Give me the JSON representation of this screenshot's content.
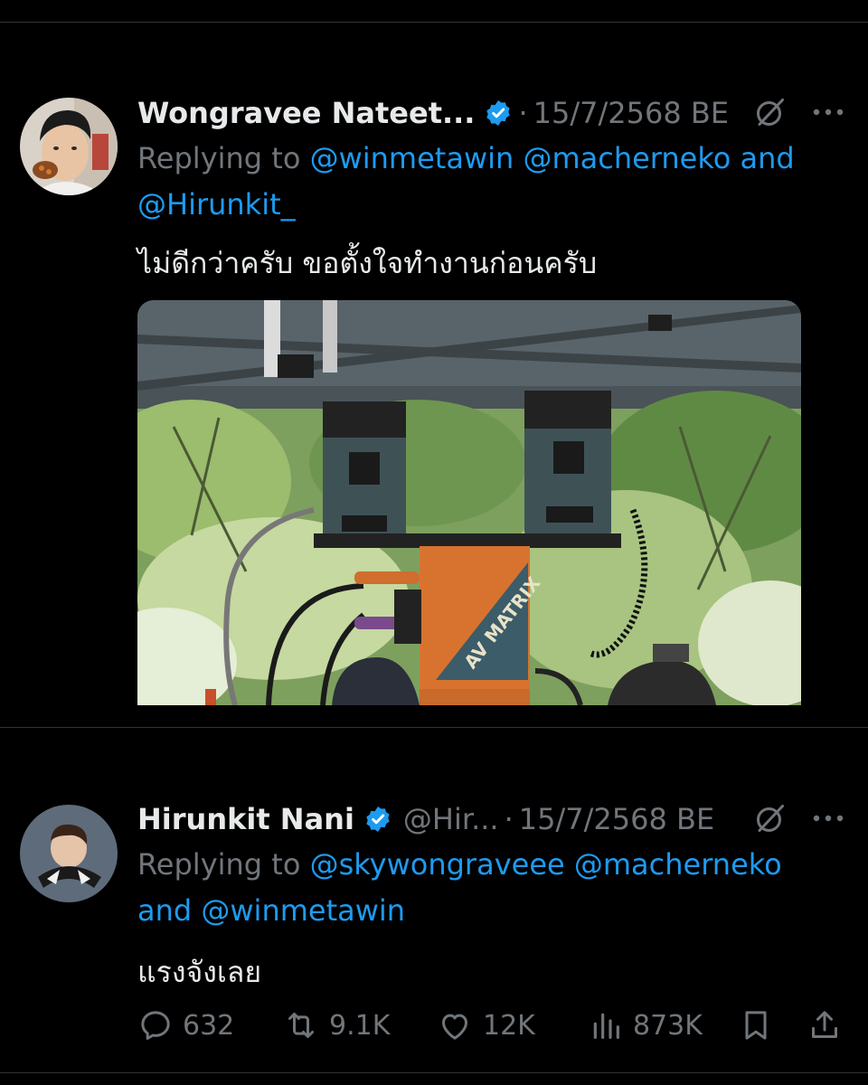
{
  "tweets": [
    {
      "display_name": "Wongravee Nateet...",
      "handle": "",
      "dot": "·",
      "timestamp": "15/7/2568 BE",
      "replying_prefix": "Replying to",
      "mentions": [
        "@winmetawin",
        "@macherneko"
      ],
      "replying_and": "and",
      "mention_last": "@Hirunkit_",
      "text": "ไม่ดีกว่าครับ ขอตั้งใจทำงานก่อนครับ",
      "media_text": "AV MATRIX"
    },
    {
      "display_name": "Hirunkit Nani",
      "handle": "@Hir...",
      "dot": "·",
      "timestamp": "15/7/2568 BE",
      "replying_prefix": "Replying to",
      "mentions": [
        "@skywongraveee",
        "@macherneko"
      ],
      "replying_and": "and",
      "mention_last": "@winmetawin",
      "text": "แรงจังเลย"
    }
  ],
  "actions": {
    "replies": "632",
    "reposts": "9.1K",
    "likes": "12K",
    "views": "873K"
  },
  "icons": {
    "verified": "verified-badge-icon",
    "grok": "grok-icon",
    "more": "more-icon",
    "reply": "reply-icon",
    "repost": "repost-icon",
    "like": "like-icon",
    "views": "views-icon",
    "bookmark": "bookmark-icon",
    "share": "share-icon"
  },
  "colors": {
    "background": "#000000",
    "text": "#e7e9ea",
    "secondary": "#71767b",
    "accent": "#1d9bf0"
  }
}
